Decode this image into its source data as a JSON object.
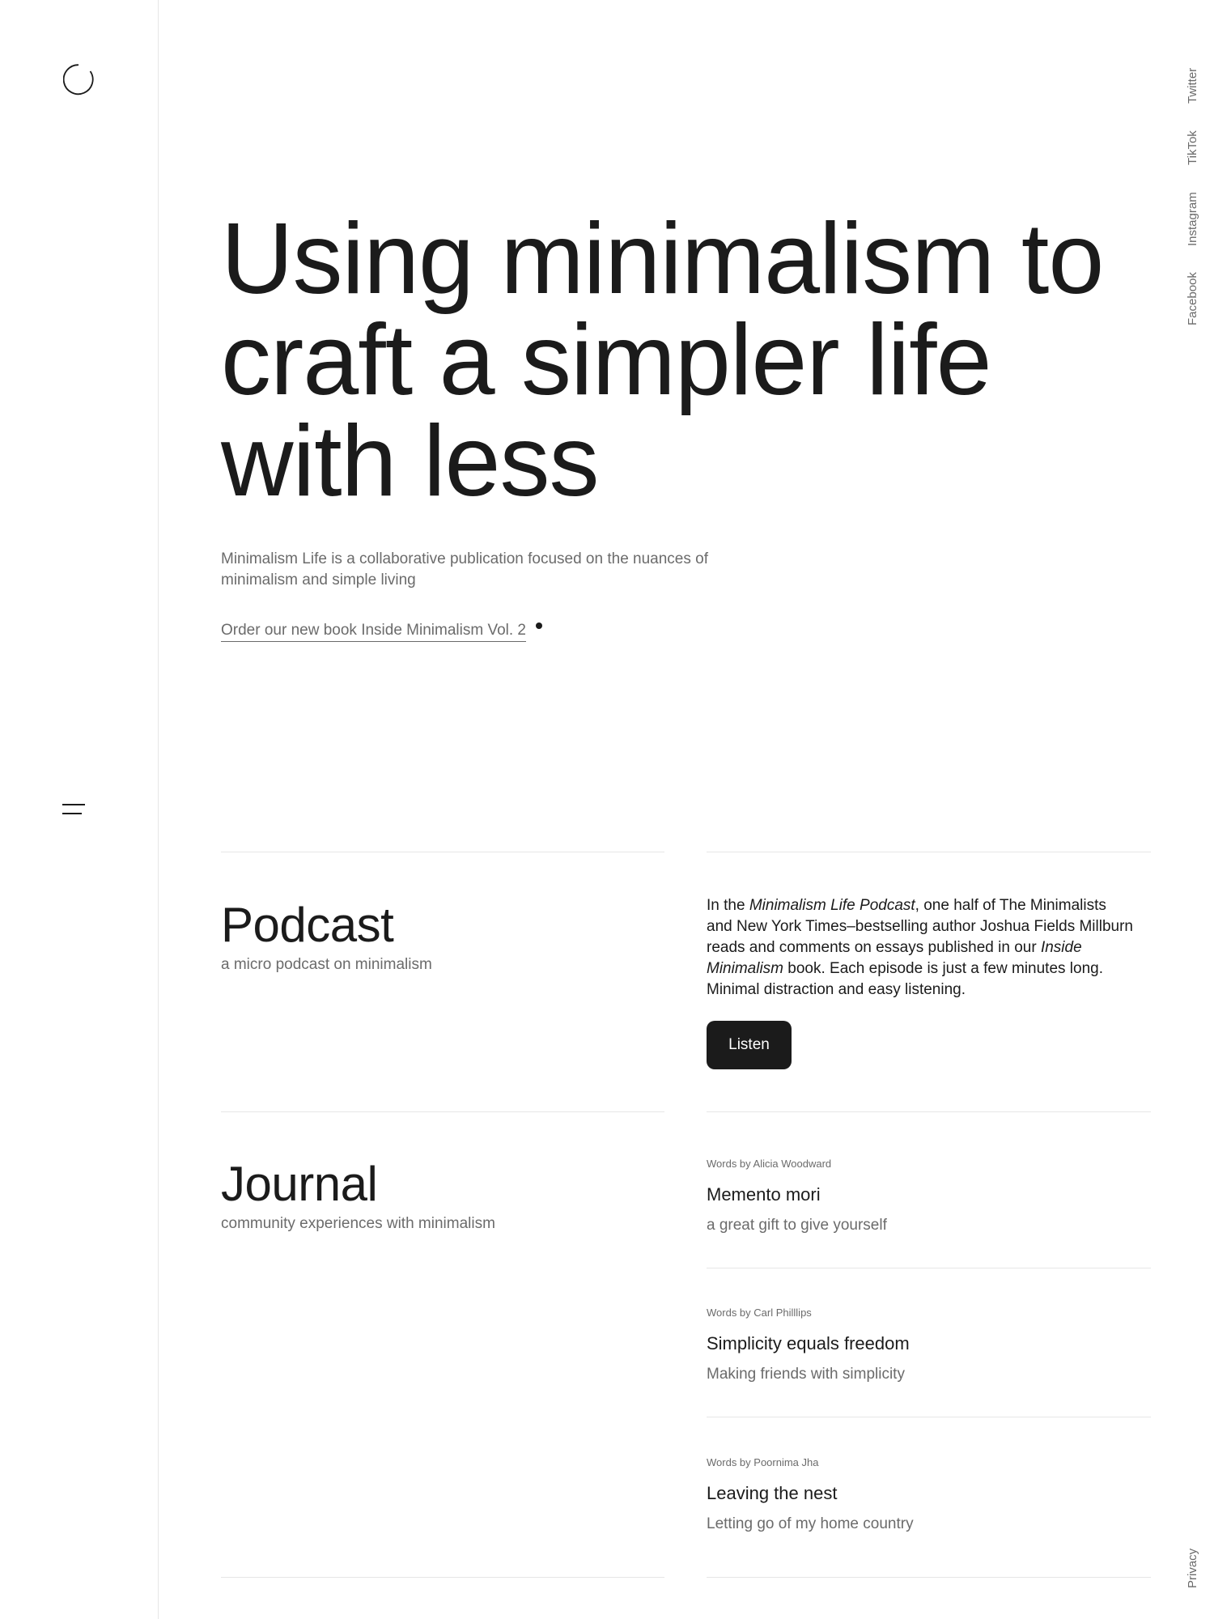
{
  "social": [
    "Twitter",
    "TikTok",
    "Instagram",
    "Facebook"
  ],
  "privacy": "Privacy",
  "hero": {
    "title": "Using minimalism to craft a simpler life with less",
    "subtitle": "Minimalism Life is a collaborative publication focused on the nuances of minimalism and simple living",
    "book_link": "Order our new book Inside Minimalism Vol. 2"
  },
  "podcast": {
    "title": "Podcast",
    "subtitle": "a micro podcast on minimalism",
    "desc_1": "In the ",
    "desc_em_1": "Minimalism Life Podcast",
    "desc_2": ", one half of The Minimalists and New York Times–bestselling author Joshua Fields Millburn reads and comments on essays published in our ",
    "desc_em_2": "Inside Minimalism",
    "desc_3": " book. Each episode is just a few minutes long. Minimal distraction and easy listening.",
    "button": "Listen"
  },
  "journal": {
    "title": "Journal",
    "subtitle": "community experiences with minimalism",
    "articles": [
      {
        "byline": "Words by Alicia Woodward",
        "title": "Memento mori",
        "subtitle": "a great gift to give yourself"
      },
      {
        "byline": "Words by Carl Philllips",
        "title": "Simplicity equals freedom",
        "subtitle": "Making friends with simplicity"
      },
      {
        "byline": "Words by Poornima Jha",
        "title": "Leaving the nest",
        "subtitle": "Letting go of my home country"
      }
    ]
  }
}
